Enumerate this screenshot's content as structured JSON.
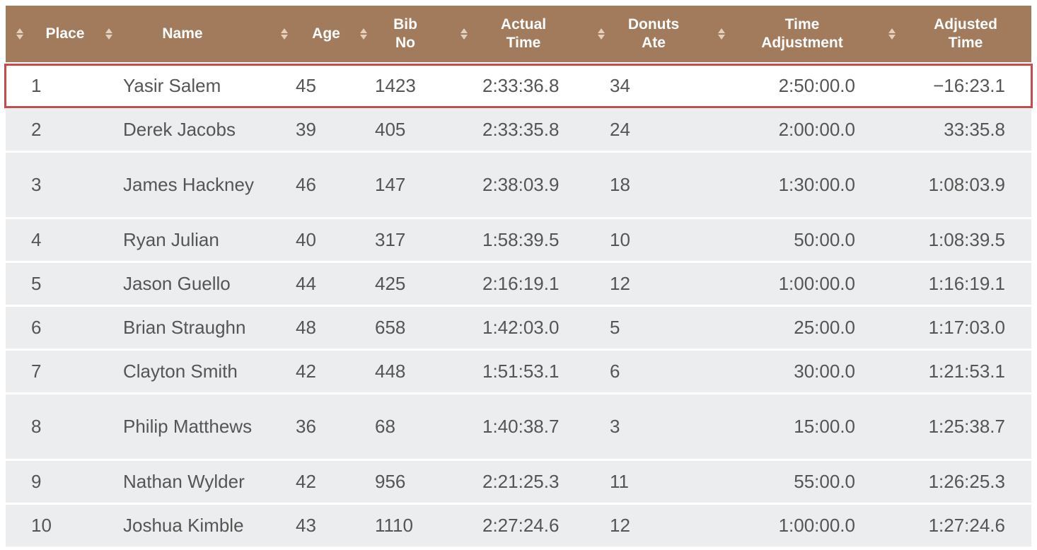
{
  "columns": [
    {
      "key": "place",
      "label": "Place"
    },
    {
      "key": "name",
      "label": "Name"
    },
    {
      "key": "age",
      "label": "Age"
    },
    {
      "key": "bib",
      "label": "Bib\nNo"
    },
    {
      "key": "actual",
      "label": "Actual\nTime"
    },
    {
      "key": "donuts",
      "label": "Donuts\nAte"
    },
    {
      "key": "adjustment",
      "label": "Time\nAdjustment"
    },
    {
      "key": "adjusted",
      "label": "Adjusted\nTime"
    }
  ],
  "rows": [
    {
      "place": "1",
      "name": "Yasir Salem",
      "age": "45",
      "bib": "1423",
      "actual": "2:33:36.8",
      "donuts": "34",
      "adjustment": "2:50:00.0",
      "adjusted": "−16:23.1",
      "highlighted": true
    },
    {
      "place": "2",
      "name": "Derek Jacobs",
      "age": "39",
      "bib": "405",
      "actual": "2:33:35.8",
      "donuts": "24",
      "adjustment": "2:00:00.0",
      "adjusted": "33:35.8",
      "highlighted": false
    },
    {
      "place": "3",
      "name": "James Hackney",
      "age": "46",
      "bib": "147",
      "actual": "2:38:03.9",
      "donuts": "18",
      "adjustment": "1:30:00.0",
      "adjusted": "1:08:03.9",
      "highlighted": false
    },
    {
      "place": "4",
      "name": "Ryan Julian",
      "age": "40",
      "bib": "317",
      "actual": "1:58:39.5",
      "donuts": "10",
      "adjustment": "50:00.0",
      "adjusted": "1:08:39.5",
      "highlighted": false
    },
    {
      "place": "5",
      "name": "Jason Guello",
      "age": "44",
      "bib": "425",
      "actual": "2:16:19.1",
      "donuts": "12",
      "adjustment": "1:00:00.0",
      "adjusted": "1:16:19.1",
      "highlighted": false
    },
    {
      "place": "6",
      "name": "Brian Straughn",
      "age": "48",
      "bib": "658",
      "actual": "1:42:03.0",
      "donuts": "5",
      "adjustment": "25:00.0",
      "adjusted": "1:17:03.0",
      "highlighted": false
    },
    {
      "place": "7",
      "name": "Clayton Smith",
      "age": "42",
      "bib": "448",
      "actual": "1:51:53.1",
      "donuts": "6",
      "adjustment": "30:00.0",
      "adjusted": "1:21:53.1",
      "highlighted": false
    },
    {
      "place": "8",
      "name": "Philip Matthews",
      "age": "36",
      "bib": "68",
      "actual": "1:40:38.7",
      "donuts": "3",
      "adjustment": "15:00.0",
      "adjusted": "1:25:38.7",
      "highlighted": false
    },
    {
      "place": "9",
      "name": "Nathan Wylder",
      "age": "42",
      "bib": "956",
      "actual": "2:21:25.3",
      "donuts": "11",
      "adjustment": "55:00.0",
      "adjusted": "1:26:25.3",
      "highlighted": false
    },
    {
      "place": "10",
      "name": "Joshua Kimble",
      "age": "43",
      "bib": "1110",
      "actual": "2:27:24.6",
      "donuts": "12",
      "adjustment": "1:00:00.0",
      "adjusted": "1:27:24.6",
      "highlighted": false
    }
  ],
  "colors": {
    "header_bg": "#a27b5c",
    "row_bg": "#ecedee",
    "highlight_border": "#c94a4a"
  }
}
